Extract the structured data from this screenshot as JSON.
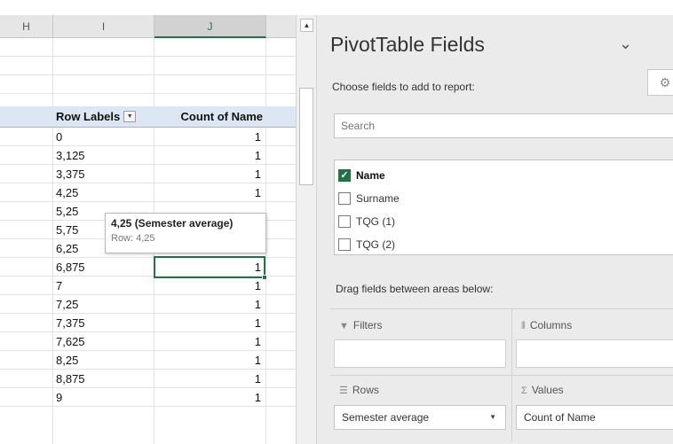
{
  "sheet": {
    "columns": [
      "H",
      "I",
      "J"
    ],
    "pivot": {
      "row_labels_header": "Row Labels",
      "count_header": "Count of Name",
      "rows": [
        {
          "label": "0",
          "count": "1"
        },
        {
          "label": "3,125",
          "count": "1"
        },
        {
          "label": "3,375",
          "count": "1"
        },
        {
          "label": "4,25",
          "count": "1"
        },
        {
          "label": "5,25",
          "count": ""
        },
        {
          "label": "5,75",
          "count": ""
        },
        {
          "label": "6,25",
          "count": "1"
        },
        {
          "label": "6,875",
          "count": "1"
        },
        {
          "label": "7",
          "count": "1"
        },
        {
          "label": "7,25",
          "count": "1"
        },
        {
          "label": "7,375",
          "count": "1"
        },
        {
          "label": "7,625",
          "count": "1"
        },
        {
          "label": "8,25",
          "count": "1"
        },
        {
          "label": "8,875",
          "count": "1"
        },
        {
          "label": "9",
          "count": "1"
        }
      ]
    },
    "tooltip": {
      "title": "4,25 (Semester average)",
      "subtitle": "Row: 4,25"
    }
  },
  "pane": {
    "title": "PivotTable Fields",
    "subtitle": "Choose fields to add to report:",
    "search_placeholder": "Search",
    "fields": [
      {
        "label": "Name",
        "checked": true
      },
      {
        "label": "Surname",
        "checked": false
      },
      {
        "label": "TQG (1)",
        "checked": false
      },
      {
        "label": "TQG (2)",
        "checked": false
      }
    ],
    "drag_label": "Drag fields between areas below:",
    "areas": {
      "filters": "Filters",
      "columns": "Columns",
      "rows": "Rows",
      "values": "Values",
      "rows_item": "Semester average",
      "values_item": "Count of Name"
    }
  }
}
